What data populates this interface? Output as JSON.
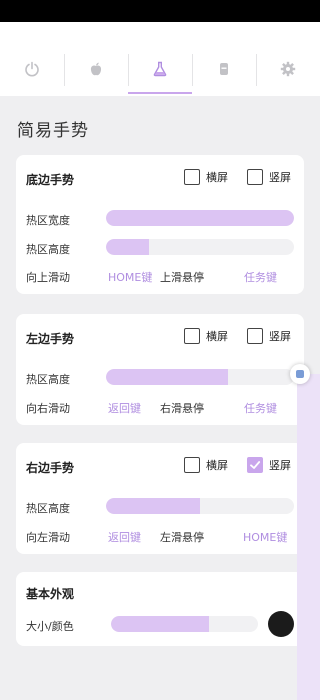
{
  "tabs": [
    {
      "icon": "power-icon",
      "active": false
    },
    {
      "icon": "apple-icon",
      "active": false
    },
    {
      "icon": "flask-icon",
      "active": true
    },
    {
      "icon": "phone-icon",
      "active": false
    },
    {
      "icon": "gear-icon",
      "active": false
    }
  ],
  "page": {
    "title": "简易手势"
  },
  "bottom_gesture": {
    "title": "底边手势",
    "landscape_label": "横屏",
    "landscape_checked": false,
    "portrait_label": "竖屏",
    "portrait_checked": false,
    "width_label": "热区宽度",
    "width_value": 1.0,
    "height_label": "热区高度",
    "height_value": 0.23,
    "swipe_label": "向上滑动",
    "action1": "HOME键",
    "action2": "上滑悬停",
    "action3": "任务键"
  },
  "left_gesture": {
    "title": "左边手势",
    "landscape_label": "横屏",
    "landscape_checked": false,
    "portrait_label": "竖屏",
    "portrait_checked": false,
    "height_label": "热区高度",
    "height_value": 0.65,
    "swipe_label": "向右滑动",
    "action1": "返回键",
    "action2": "右滑悬停",
    "action3": "任务键"
  },
  "right_gesture": {
    "title": "右边手势",
    "landscape_label": "横屏",
    "landscape_checked": false,
    "portrait_label": "竖屏",
    "portrait_checked": true,
    "height_label": "热区高度",
    "height_value": 0.5,
    "swipe_label": "向左滑动",
    "action1": "返回键",
    "action2": "左滑悬停",
    "action3": "HOME键"
  },
  "appearance": {
    "title": "基本外观",
    "size_color_label": "大小/颜色",
    "size_value": 0.67,
    "color": "#1b1b1b"
  },
  "accent_color": "#c9a6ec"
}
